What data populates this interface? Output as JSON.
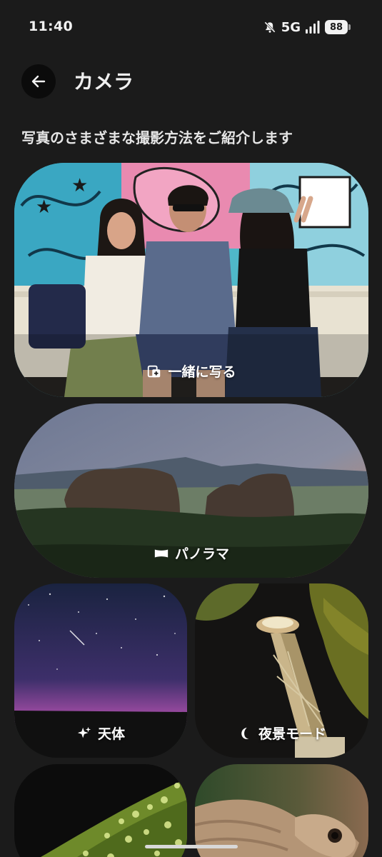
{
  "status_bar": {
    "time": "11:40",
    "network": "5G",
    "battery": "88",
    "icons": [
      "mute-icon",
      "signal-icon",
      "battery-icon"
    ]
  },
  "header": {
    "back_icon": "arrow-left-icon",
    "title": "カメラ"
  },
  "subtitle": "写真のさまざまな撮影方法をご紹介します",
  "cards": {
    "together": {
      "label": "一緒に写る",
      "icon": "add-me-icon"
    },
    "panorama": {
      "label": "パノラマ",
      "icon": "panorama-icon"
    },
    "astro": {
      "label": "天体",
      "icon": "sparkle-icon"
    },
    "night": {
      "label": "夜景モード",
      "icon": "moon-icon"
    },
    "macro": {
      "label": ""
    },
    "portrait": {
      "label": ""
    }
  },
  "colors": {
    "background": "#1b1b1b",
    "text": "#e9e9e9",
    "back_button": "#0b0b0b"
  }
}
